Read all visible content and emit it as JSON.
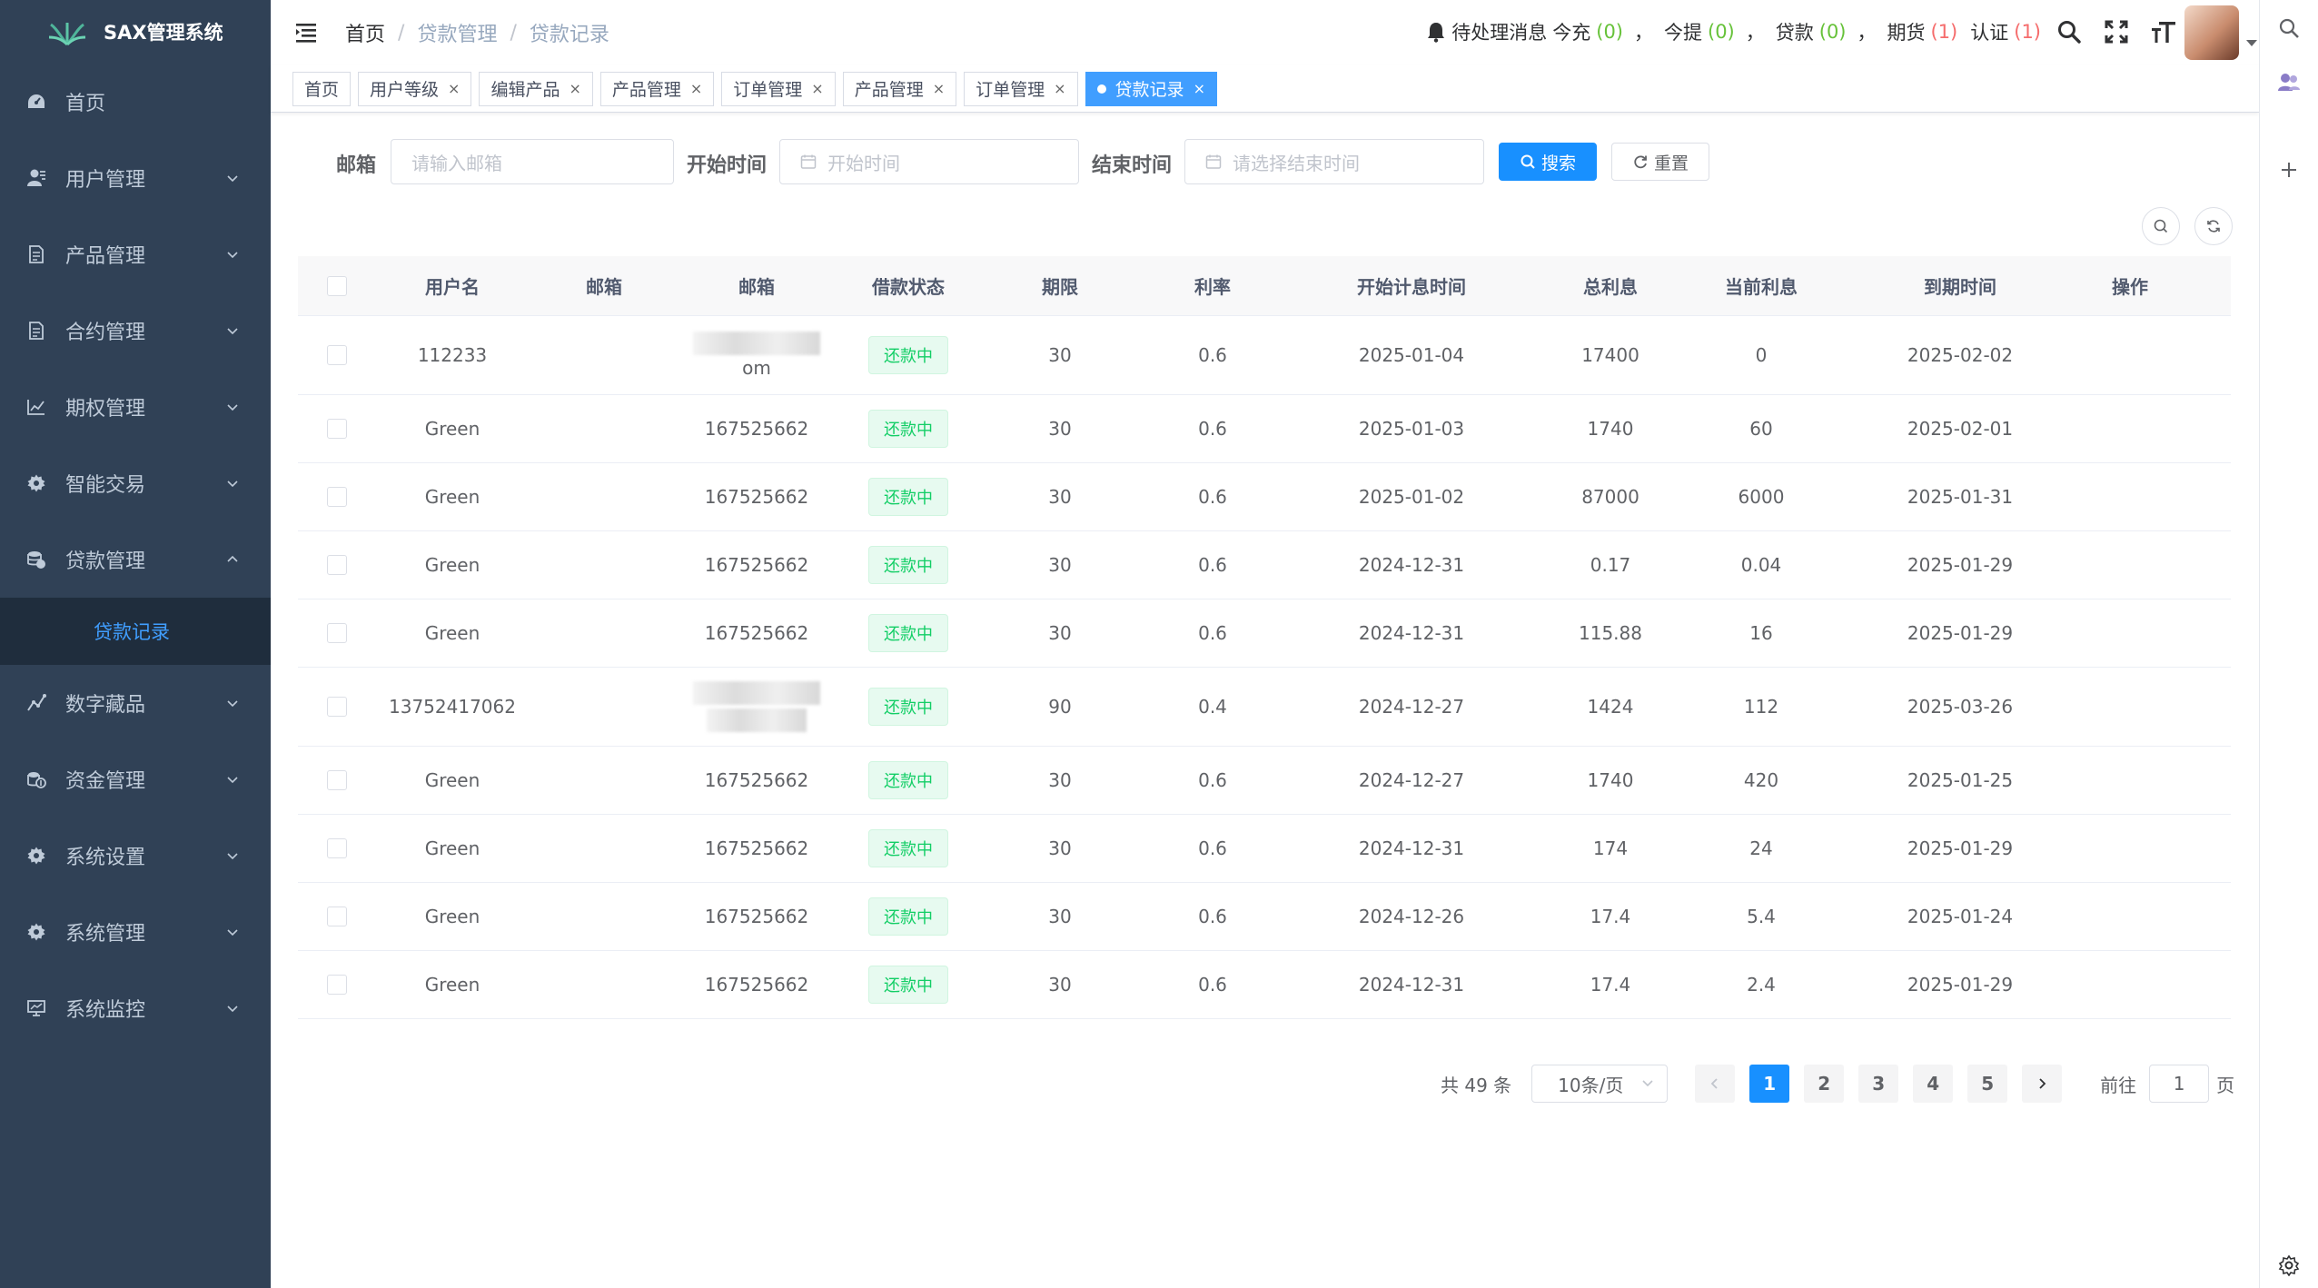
{
  "app": {
    "title": "SAX管理系统"
  },
  "sidebar": {
    "items": [
      {
        "label": "首页",
        "icon": "dashboard-icon"
      },
      {
        "label": "用户管理",
        "icon": "user-icon"
      },
      {
        "label": "产品管理",
        "icon": "document-icon"
      },
      {
        "label": "合约管理",
        "icon": "document-icon"
      },
      {
        "label": "期权管理",
        "icon": "chart-icon"
      },
      {
        "label": "智能交易",
        "icon": "gear-icon"
      },
      {
        "label": "贷款管理",
        "icon": "coins-icon"
      },
      {
        "label": "数字藏品",
        "icon": "trend-icon"
      },
      {
        "label": "资金管理",
        "icon": "money-icon"
      },
      {
        "label": "系统设置",
        "icon": "gear-icon"
      },
      {
        "label": "系统管理",
        "icon": "gear-icon"
      },
      {
        "label": "系统监控",
        "icon": "monitor-icon"
      }
    ],
    "active_sub": "贷款记录"
  },
  "breadcrumb": [
    "首页",
    "贷款管理",
    "贷款记录"
  ],
  "notice": {
    "label": "待处理消息",
    "items": [
      {
        "name": "今充",
        "count": "(0)",
        "color": "#67c23a"
      },
      {
        "name": "今提",
        "count": "(0)",
        "color": "#67c23a"
      },
      {
        "name": "贷款",
        "count": "(0)",
        "color": "#67c23a"
      },
      {
        "name": "期货",
        "count": "(1)",
        "color": "#f56c6c"
      },
      {
        "name": "认证",
        "count": "(1)",
        "color": "#f56c6c"
      }
    ],
    "comma": "，"
  },
  "tags": [
    "首页",
    "用户等级",
    "编辑产品",
    "产品管理",
    "订单管理",
    "产品管理",
    "订单管理",
    "贷款记录"
  ],
  "filter": {
    "email_label": "邮箱",
    "email_placeholder": "请输入邮箱",
    "start_label": "开始时间",
    "start_placeholder": "开始时间",
    "end_label": "结束时间",
    "end_placeholder": "请选择结束时间",
    "search_label": "搜索",
    "reset_label": "重置"
  },
  "table": {
    "headers": [
      "用户名",
      "邮箱",
      "邮箱",
      "借款状态",
      "期限",
      "利率",
      "开始计息时间",
      "总利息",
      "当前利息",
      "到期时间",
      "操作"
    ],
    "rows": [
      {
        "username": "112233",
        "email1": "",
        "email2": "om",
        "email_blur": true,
        "status": "还款中",
        "term": "30",
        "rate": "0.6",
        "start": "2025-01-04",
        "total": "17400",
        "current": "0",
        "due": "2025-02-02"
      },
      {
        "username": "Green",
        "email1": "",
        "email2": "167525662",
        "email_blur": false,
        "status": "还款中",
        "term": "30",
        "rate": "0.6",
        "start": "2025-01-03",
        "total": "1740",
        "current": "60",
        "due": "2025-02-01"
      },
      {
        "username": "Green",
        "email1": "",
        "email2": "167525662",
        "email_blur": false,
        "status": "还款中",
        "term": "30",
        "rate": "0.6",
        "start": "2025-01-02",
        "total": "87000",
        "current": "6000",
        "due": "2025-01-31"
      },
      {
        "username": "Green",
        "email1": "",
        "email2": "167525662",
        "email_blur": false,
        "status": "还款中",
        "term": "30",
        "rate": "0.6",
        "start": "2024-12-31",
        "total": "0.17",
        "current": "0.04",
        "due": "2025-01-29"
      },
      {
        "username": "Green",
        "email1": "",
        "email2": "167525662",
        "email_blur": false,
        "status": "还款中",
        "term": "30",
        "rate": "0.6",
        "start": "2024-12-31",
        "total": "115.88",
        "current": "16",
        "due": "2025-01-29"
      },
      {
        "username": "13752417062",
        "email1": "",
        "email2": "",
        "email_blur": true,
        "status": "还款中",
        "term": "90",
        "rate": "0.4",
        "start": "2024-12-27",
        "total": "1424",
        "current": "112",
        "due": "2025-03-26"
      },
      {
        "username": "Green",
        "email1": "",
        "email2": "167525662",
        "email_blur": false,
        "status": "还款中",
        "term": "30",
        "rate": "0.6",
        "start": "2024-12-27",
        "total": "1740",
        "current": "420",
        "due": "2025-01-25"
      },
      {
        "username": "Green",
        "email1": "",
        "email2": "167525662",
        "email_blur": false,
        "status": "还款中",
        "term": "30",
        "rate": "0.6",
        "start": "2024-12-31",
        "total": "174",
        "current": "24",
        "due": "2025-01-29"
      },
      {
        "username": "Green",
        "email1": "",
        "email2": "167525662",
        "email_blur": false,
        "status": "还款中",
        "term": "30",
        "rate": "0.6",
        "start": "2024-12-26",
        "total": "17.4",
        "current": "5.4",
        "due": "2025-01-24"
      },
      {
        "username": "Green",
        "email1": "",
        "email2": "167525662",
        "email_blur": false,
        "status": "还款中",
        "term": "30",
        "rate": "0.6",
        "start": "2024-12-31",
        "total": "17.4",
        "current": "2.4",
        "due": "2025-01-29"
      }
    ]
  },
  "pagination": {
    "total_text": "共 49 条",
    "page_size": "10条/页",
    "pages": [
      "1",
      "2",
      "3",
      "4",
      "5"
    ],
    "current": "1",
    "goto_label": "前往",
    "goto_value": "1",
    "page_suffix": "页"
  },
  "colors": {
    "sidebar_bg": "#304156",
    "accent": "#1890ff",
    "success": "#13ce66",
    "danger": "#f56c6c"
  }
}
